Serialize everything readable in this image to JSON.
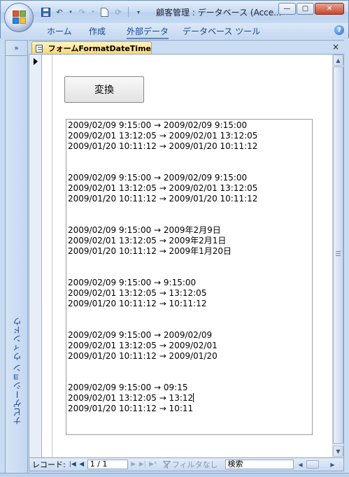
{
  "window": {
    "title": "顧客管理 : データベース (Acce...",
    "minimize_glyph": "—",
    "maximize_glyph": "▢",
    "close_glyph": "✕"
  },
  "ribbon": {
    "tabs": [
      {
        "label": "ホーム"
      },
      {
        "label": "作成"
      },
      {
        "label": "外部データ"
      },
      {
        "label": "データベース ツール"
      }
    ],
    "help_glyph": "?"
  },
  "navpane": {
    "toggle_glyph": "»",
    "label": "ナビゲーション ウィンドウ"
  },
  "document_tab": {
    "label": "フォームFormatDateTime",
    "close_glyph": "×"
  },
  "form": {
    "convert_button_label": "変換",
    "output_groups": [
      [
        "2009/02/09 9:15:00 → 2009/02/09 9:15:00",
        "2009/02/01 13:12:05 → 2009/02/01 13:12:05",
        "2009/01/20 10:11:12 → 2009/01/20 10:11:12"
      ],
      [
        "2009/02/09 9:15:00 → 2009/02/09 9:15:00",
        "2009/02/01 13:12:05 → 2009/02/01 13:12:05",
        "2009/01/20 10:11:12 → 2009/01/20 10:11:12"
      ],
      [
        "2009/02/09 9:15:00 → 2009年2月9日",
        "2009/02/01 13:12:05 → 2009年2月1日",
        "2009/01/20 10:11:12 → 2009年1月20日"
      ],
      [
        "2009/02/09 9:15:00 → 9:15:00",
        "2009/02/01 13:12:05 → 13:12:05",
        "2009/01/20 10:11:12 → 10:11:12"
      ],
      [
        "2009/02/09 9:15:00 → 2009/02/09",
        "2009/02/01 13:12:05 → 2009/02/01",
        "2009/01/20 10:11:12 → 2009/01/20"
      ],
      [
        "2009/02/09 9:15:00 → 09:15",
        "2009/02/01 13:12:05 → 13:12",
        "2009/01/20 10:11:12 → 10:11"
      ]
    ]
  },
  "record_nav": {
    "label": "レコード:",
    "first_glyph": "|◀",
    "prev_glyph": "◀",
    "current": "1 / 1",
    "next_glyph": "▶",
    "last_glyph": "▶|",
    "new_glyph": "▶*",
    "filter_label": "フィルタなし",
    "search_placeholder": "検索"
  }
}
